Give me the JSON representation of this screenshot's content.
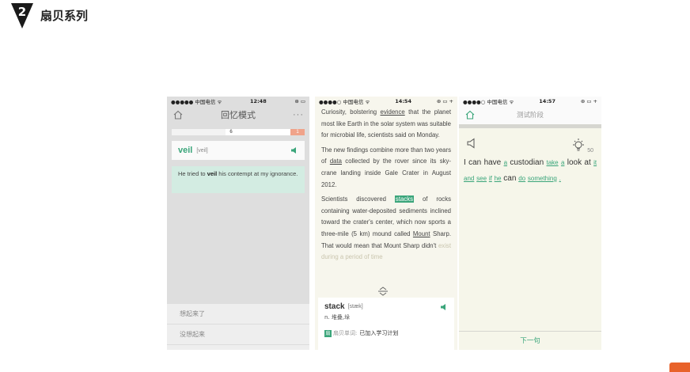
{
  "slide": {
    "number": "2",
    "title": "扇贝系列"
  },
  "phone1": {
    "status": {
      "carrier": "●●●●● 中国电信 ᯤ",
      "time": "12:48",
      "battery": "⊛ ▭"
    },
    "nav": {
      "title": "回忆模式",
      "more": "···"
    },
    "progress": {
      "count": "6",
      "badge": "1",
      "fraction": 0.45
    },
    "word": {
      "text": "veil",
      "phonetic": "[veil]"
    },
    "sentence": {
      "before": "He tried to ",
      "keyword": "veil",
      "after": " his contempt at my ignorance."
    },
    "actions": [
      "想起来了",
      "没想起来"
    ]
  },
  "phone2": {
    "status": {
      "carrier": "●●●●○ 中国电信 ᯤ",
      "time": "14:54",
      "battery": "⊛ ▭ +"
    },
    "paragraphs": [
      [
        {
          "t": "Curiosity, bolstering "
        },
        {
          "t": "evidence",
          "u": true
        },
        {
          "t": " that the planet most like Earth in the solar system was suitable for microbial life, scientists said on Monday."
        }
      ],
      [
        {
          "t": "The new findings combine more than two years of "
        },
        {
          "t": "data",
          "u": true
        },
        {
          "t": " collected by the rover since its sky-crane landing inside Gale Crater in August 2012."
        }
      ],
      [
        {
          "t": "Scientists discovered "
        },
        {
          "t": "stacks",
          "h": true
        },
        {
          "t": " of rocks containing water-deposited sediments inclined toward the crater's center, which now sports a three-mile (5 km) mound called "
        },
        {
          "t": "Mount",
          "u": true
        },
        {
          "t": " Sharp. That would mean that Mount Sharp didn't "
        },
        {
          "t": "exist during a period of time",
          "f": true
        }
      ]
    ],
    "popup": {
      "word": "stack",
      "phonetic": "[stæk]",
      "definition": "n. 堆叠,垛",
      "badge": "扇",
      "source": "扇贝单词:",
      "plan": "已加入学习计划"
    }
  },
  "phone3": {
    "status": {
      "carrier": "●●●●○ 中国电信 ᯤ",
      "time": "14:57",
      "battery": "⊛ ▭ +"
    },
    "nav": {
      "title": "测试阶段"
    },
    "hint_count": "50",
    "tokens": [
      {
        "t": "I"
      },
      {
        "t": "can"
      },
      {
        "t": "have"
      },
      {
        "t": "a",
        "b": true
      },
      {
        "t": "custodian"
      },
      {
        "t": "take",
        "b": true
      },
      {
        "t": "a",
        "b": true
      },
      {
        "t": "look"
      },
      {
        "t": "at"
      },
      {
        "t": "it",
        "b": true
      },
      {
        "t": "and",
        "b": true
      },
      {
        "t": "see",
        "b": true
      },
      {
        "t": "if",
        "b": true
      },
      {
        "t": "he",
        "b": true
      },
      {
        "t": "can"
      },
      {
        "t": "do",
        "b": true
      },
      {
        "t": "something",
        "b": true
      },
      {
        "t": ".",
        "b": true
      }
    ],
    "next_label": "下一句"
  },
  "colors": {
    "accent": "#3aa57a",
    "badge": "#f0a38a",
    "corner": "#e8622a"
  },
  "icons": [
    "home-icon",
    "more-icon",
    "speaker-icon",
    "drag-handle-icon",
    "lightbulb-icon"
  ]
}
